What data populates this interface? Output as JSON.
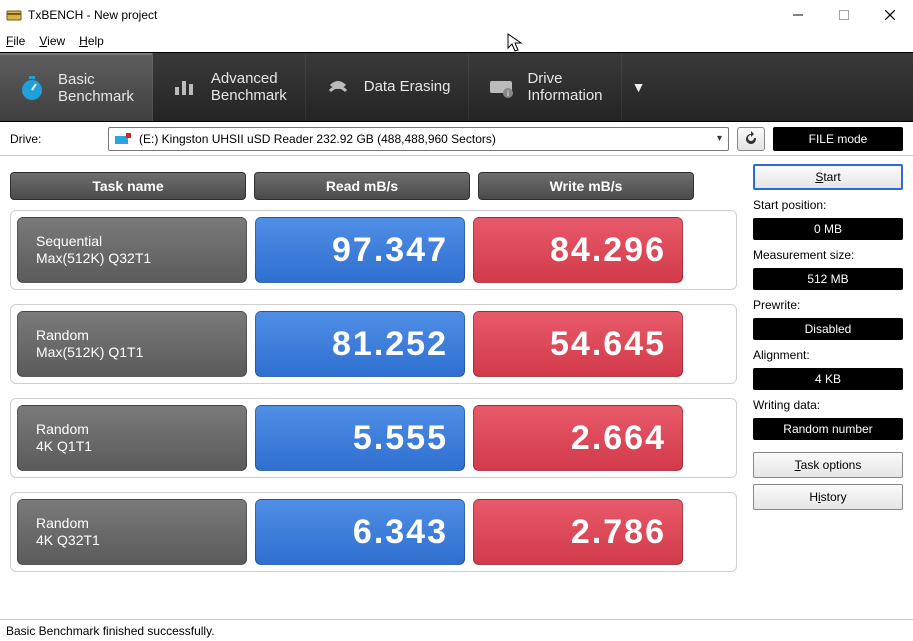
{
  "window": {
    "title": "TxBENCH - New project"
  },
  "menu": {
    "file": "File",
    "view": "View",
    "help": "Help"
  },
  "tabs": {
    "basic": {
      "l1": "Basic",
      "l2": "Benchmark"
    },
    "advanced": {
      "l1": "Advanced",
      "l2": "Benchmark"
    },
    "erase": {
      "l1": "Data Erasing"
    },
    "drive": {
      "l1": "Drive",
      "l2": "Information"
    }
  },
  "drive": {
    "label": "Drive:",
    "value": "(E:) Kingston UHSII uSD Reader  232.92 GB (488,488,960 Sectors)"
  },
  "file_mode": "FILE mode",
  "headers": {
    "task": "Task name",
    "read": "Read mB/s",
    "write": "Write mB/s"
  },
  "rows": [
    {
      "name1": "Sequential",
      "name2": "Max(512K) Q32T1",
      "read": "97.347",
      "write": "84.296"
    },
    {
      "name1": "Random",
      "name2": "Max(512K) Q1T1",
      "read": "81.252",
      "write": "54.645"
    },
    {
      "name1": "Random",
      "name2": "4K Q1T1",
      "read": "5.555",
      "write": "2.664"
    },
    {
      "name1": "Random",
      "name2": "4K Q32T1",
      "read": "6.343",
      "write": "2.786"
    }
  ],
  "side": {
    "start": "Start",
    "start_pos_label": "Start position:",
    "start_pos": "0 MB",
    "meas_size_label": "Measurement size:",
    "meas_size": "512 MB",
    "prewrite_label": "Prewrite:",
    "prewrite": "Disabled",
    "align_label": "Alignment:",
    "align": "4 KB",
    "wdata_label": "Writing data:",
    "wdata": "Random number",
    "task_options": "Task options",
    "history": "History"
  },
  "status": "Basic Benchmark finished successfully."
}
